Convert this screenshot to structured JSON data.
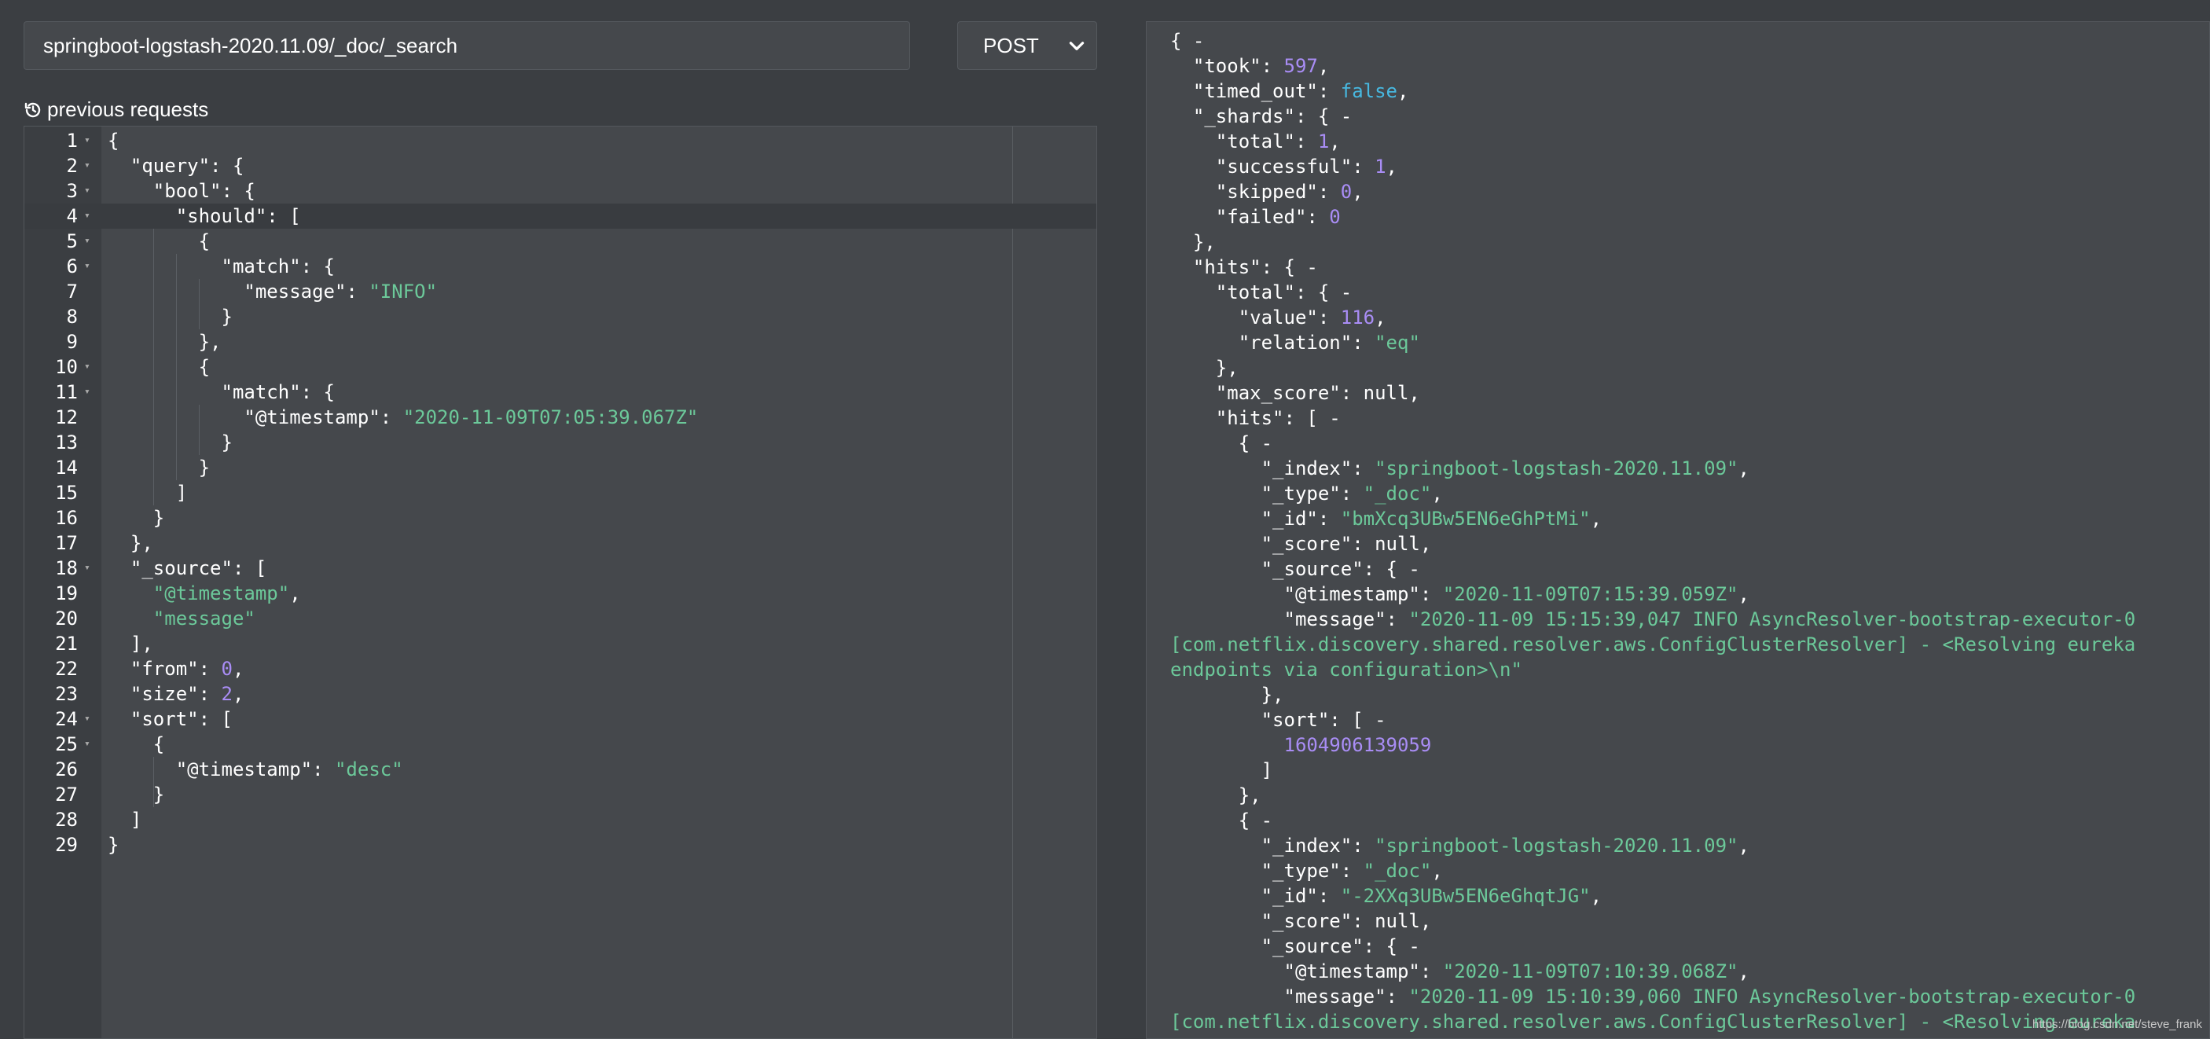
{
  "request": {
    "url": "springboot-logstash-2020.11.09/_doc/_search",
    "method": "POST",
    "previous_requests_label": "previous requests",
    "active_line": 4,
    "lines": [
      [
        [
          "k",
          "{"
        ]
      ],
      [
        [
          "k",
          "  \"query\": {"
        ]
      ],
      [
        [
          "k",
          "    \"bool\": {"
        ]
      ],
      [
        [
          "k",
          "      \"should\": ["
        ]
      ],
      [
        [
          "k",
          "        {"
        ]
      ],
      [
        [
          "k",
          "          \"match\": {"
        ]
      ],
      [
        [
          "k",
          "            \"message\": "
        ],
        [
          "s",
          "\"INFO\""
        ]
      ],
      [
        [
          "k",
          "          }"
        ]
      ],
      [
        [
          "k",
          "        },"
        ]
      ],
      [
        [
          "k",
          "        {"
        ]
      ],
      [
        [
          "k",
          "          \"match\": {"
        ]
      ],
      [
        [
          "k",
          "            \"@timestamp\": "
        ],
        [
          "s",
          "\"2020-11-09T07:05:39.067Z\""
        ]
      ],
      [
        [
          "k",
          "          }"
        ]
      ],
      [
        [
          "k",
          "        }"
        ]
      ],
      [
        [
          "k",
          "      ]"
        ]
      ],
      [
        [
          "k",
          "    }"
        ]
      ],
      [
        [
          "k",
          "  },"
        ]
      ],
      [
        [
          "k",
          "  \"_source\": ["
        ]
      ],
      [
        [
          "s",
          "    \"@timestamp\""
        ],
        [
          "k",
          ","
        ]
      ],
      [
        [
          "s",
          "    \"message\""
        ]
      ],
      [
        [
          "k",
          "  ],"
        ]
      ],
      [
        [
          "k",
          "  \"from\": "
        ],
        [
          "n",
          "0"
        ],
        [
          "k",
          ","
        ]
      ],
      [
        [
          "k",
          "  \"size\": "
        ],
        [
          "n",
          "2"
        ],
        [
          "k",
          ","
        ]
      ],
      [
        [
          "k",
          "  \"sort\": ["
        ]
      ],
      [
        [
          "k",
          "    {"
        ]
      ],
      [
        [
          "k",
          "      \"@timestamp\": "
        ],
        [
          "s",
          "\"desc\""
        ]
      ],
      [
        [
          "k",
          "    }"
        ]
      ],
      [
        [
          "k",
          "  ]"
        ]
      ],
      [
        [
          "k",
          "}"
        ]
      ]
    ],
    "foldable_lines": [
      1,
      2,
      3,
      4,
      5,
      6,
      10,
      11,
      18,
      24,
      25
    ]
  },
  "response": {
    "lines": [
      [
        [
          "k",
          "{ -"
        ]
      ],
      [
        [
          "k",
          "  \"took\": "
        ],
        [
          "n",
          "597"
        ],
        [
          "k",
          ","
        ]
      ],
      [
        [
          "k",
          "  \"timed_out\": "
        ],
        [
          "b",
          "false"
        ],
        [
          "k",
          ","
        ]
      ],
      [
        [
          "k",
          "  \"_shards\": { -"
        ]
      ],
      [
        [
          "k",
          "    \"total\": "
        ],
        [
          "n",
          "1"
        ],
        [
          "k",
          ","
        ]
      ],
      [
        [
          "k",
          "    \"successful\": "
        ],
        [
          "n",
          "1"
        ],
        [
          "k",
          ","
        ]
      ],
      [
        [
          "k",
          "    \"skipped\": "
        ],
        [
          "n",
          "0"
        ],
        [
          "k",
          ","
        ]
      ],
      [
        [
          "k",
          "    \"failed\": "
        ],
        [
          "n",
          "0"
        ]
      ],
      [
        [
          "k",
          "  },"
        ]
      ],
      [
        [
          "k",
          "  \"hits\": { -"
        ]
      ],
      [
        [
          "k",
          "    \"total\": { -"
        ]
      ],
      [
        [
          "k",
          "      \"value\": "
        ],
        [
          "n",
          "116"
        ],
        [
          "k",
          ","
        ]
      ],
      [
        [
          "k",
          "      \"relation\": "
        ],
        [
          "s",
          "\"eq\""
        ]
      ],
      [
        [
          "k",
          "    },"
        ]
      ],
      [
        [
          "k",
          "    \"max_score\": null,"
        ]
      ],
      [
        [
          "k",
          "    \"hits\": [ -"
        ]
      ],
      [
        [
          "k",
          "      { -"
        ]
      ],
      [
        [
          "k",
          "        \"_index\": "
        ],
        [
          "s",
          "\"springboot-logstash-2020.11.09\""
        ],
        [
          "k",
          ","
        ]
      ],
      [
        [
          "k",
          "        \"_type\": "
        ],
        [
          "s",
          "\"_doc\""
        ],
        [
          "k",
          ","
        ]
      ],
      [
        [
          "k",
          "        \"_id\": "
        ],
        [
          "s",
          "\"bmXcq3UBw5EN6eGhPtMi\""
        ],
        [
          "k",
          ","
        ]
      ],
      [
        [
          "k",
          "        \"_score\": null,"
        ]
      ],
      [
        [
          "k",
          "        \"_source\": { -"
        ]
      ],
      [
        [
          "k",
          "          \"@timestamp\": "
        ],
        [
          "s",
          "\"2020-11-09T07:15:39.059Z\""
        ],
        [
          "k",
          ","
        ]
      ],
      [
        [
          "k",
          "          \"message\": "
        ],
        [
          "s",
          "\"2020-11-09 15:15:39,047 INFO AsyncResolver-bootstrap-executor-0"
        ]
      ],
      [
        [
          "s",
          "[com.netflix.discovery.shared.resolver.aws.ConfigClusterResolver] - <Resolving eureka"
        ]
      ],
      [
        [
          "s",
          "endpoints via configuration>\\n\""
        ]
      ],
      [
        [
          "k",
          "        },"
        ]
      ],
      [
        [
          "k",
          "        \"sort\": [ -"
        ]
      ],
      [
        [
          "n",
          "          1604906139059"
        ]
      ],
      [
        [
          "k",
          "        ]"
        ]
      ],
      [
        [
          "k",
          "      },"
        ]
      ],
      [
        [
          "k",
          "      { -"
        ]
      ],
      [
        [
          "k",
          "        \"_index\": "
        ],
        [
          "s",
          "\"springboot-logstash-2020.11.09\""
        ],
        [
          "k",
          ","
        ]
      ],
      [
        [
          "k",
          "        \"_type\": "
        ],
        [
          "s",
          "\"_doc\""
        ],
        [
          "k",
          ","
        ]
      ],
      [
        [
          "k",
          "        \"_id\": "
        ],
        [
          "s",
          "\"-2XXq3UBw5EN6eGhqtJG\""
        ],
        [
          "k",
          ","
        ]
      ],
      [
        [
          "k",
          "        \"_score\": null,"
        ]
      ],
      [
        [
          "k",
          "        \"_source\": { -"
        ]
      ],
      [
        [
          "k",
          "          \"@timestamp\": "
        ],
        [
          "s",
          "\"2020-11-09T07:10:39.068Z\""
        ],
        [
          "k",
          ","
        ]
      ],
      [
        [
          "k",
          "          \"message\": "
        ],
        [
          "s",
          "\"2020-11-09 15:10:39,060 INFO AsyncResolver-bootstrap-executor-0"
        ]
      ],
      [
        [
          "s",
          "[com.netflix.discovery.shared.resolver.aws.ConfigClusterResolver] - <Resolving eureka"
        ]
      ]
    ]
  },
  "watermark": "https://blog.csdn.net/steve_frank"
}
